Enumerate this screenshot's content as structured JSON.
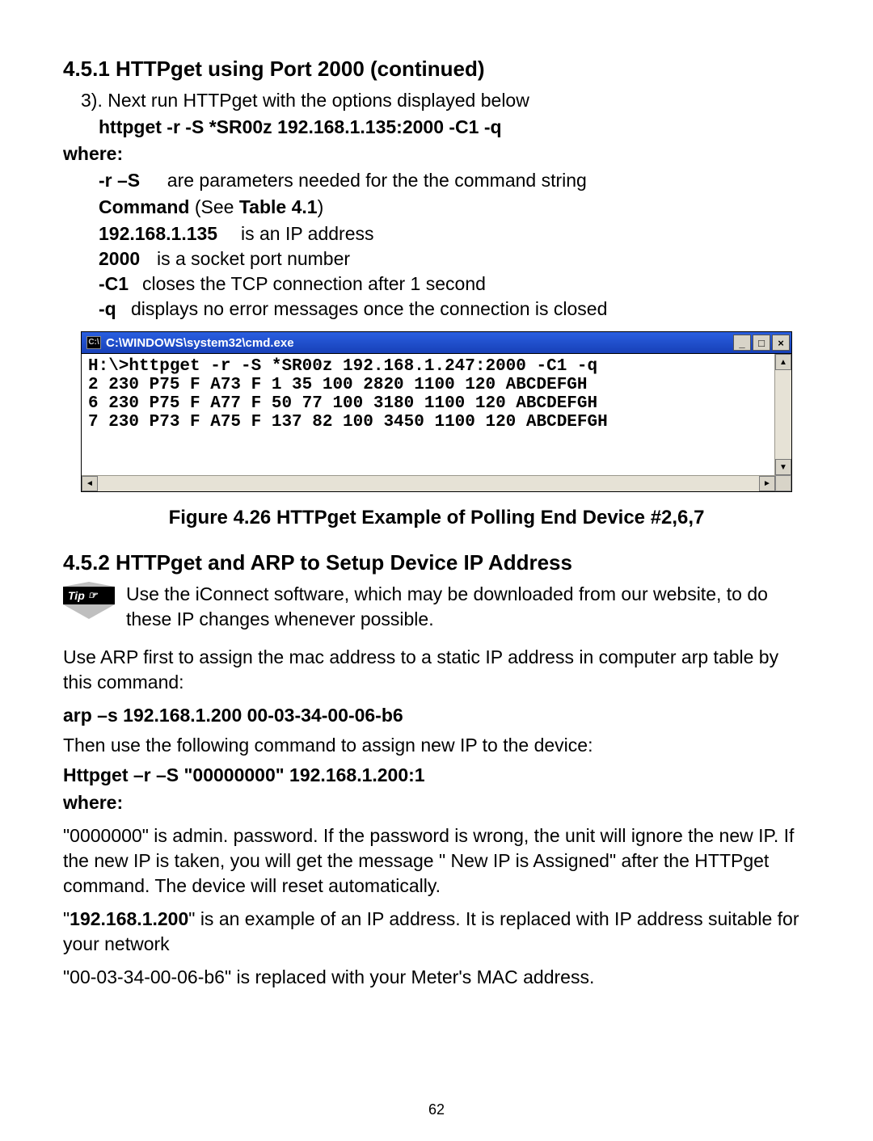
{
  "sec451": {
    "heading": "4.5.1  HTTPget using Port 2000 (continued)",
    "step3": "3).  Next run HTTPget with the options displayed below",
    "cmd": "httpget -r -S *SR00z 192.168.1.135:2000 -C1 -q",
    "where": "where:",
    "defs": {
      "rS_k": "-r  –S",
      "rS_v": "are parameters needed for the the command string",
      "command_line_a": "Command",
      "command_line_b": " (See ",
      "command_line_c": "Table 4.1",
      "command_line_d": ")",
      "ip_k": "192.168.1.135",
      "ip_v": "is an IP address",
      "port_k": "2000",
      "port_v": "is a socket port number",
      "c1_k": "-C1",
      "c1_v": "closes the TCP connection after 1 second",
      "q_k": "-q",
      "q_v": "displays no error messages once the connection is closed"
    }
  },
  "cmdwin": {
    "icon_label": "C:\\",
    "title": "C:\\WINDOWS\\system32\\cmd.exe",
    "btn_min": "_",
    "btn_max": "□",
    "btn_close": "×",
    "arrow_up": "▲",
    "arrow_down": "▼",
    "arrow_left": "◄",
    "arrow_right": "►",
    "lines": "H:\\>httpget -r -S *SR00z 192.168.1.247:2000 -C1 -q\n2 230 P75 F A73 F 1 35 100 2820 1100 120 ABCDEFGH\n6 230 P75 F A77 F 50 77 100 3180 1100 120 ABCDEFGH\n7 230 P73 F A75 F 137 82 100 3450 1100 120 ABCDEFGH"
  },
  "figure_caption": "Figure 4.26  HTTPget Example of Polling End Device #2,6,7",
  "sec452": {
    "heading": "4.5.2  HTTPget and ARP to Setup Device IP Address",
    "tip_label": "Tip",
    "tip_hand": "☞",
    "tip_text": "Use the iConnect software, which may be downloaded from our website, to do these IP changes whenever possible.",
    "arp_intro": "Use ARP first to assign the mac address to a static IP address in computer arp table by this command:",
    "arp_cmd": "arp –s 192.168.1.200 00-03-34-00-06-b6",
    "then": "Then use the following command to assign new IP to the device:",
    "httpget_cmd": "Httpget –r –S \"00000000\" 192.168.1.200:1",
    "where": "where:",
    "where_items": {
      "pw": "\"0000000\" is admin. password.  If the password is wrong, the unit will ignore the new IP. If the new IP is taken, you will get the message \" New IP is Assigned\" after the HTTPget command. The device will reset automatically.",
      "ip_a": "\"",
      "ip_b": "192.168.1.200",
      "ip_c": "\" is an example of an IP address. It is replaced with IP address suitable for your network",
      "mac": "\"00-03-34-00-06-b6\" is replaced with your Meter's MAC address."
    }
  },
  "page_number": "62"
}
